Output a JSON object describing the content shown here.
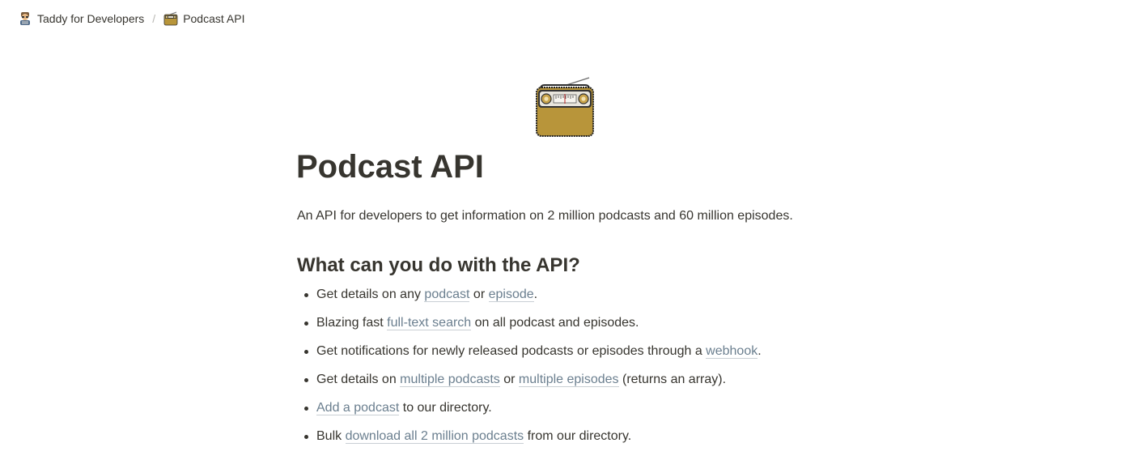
{
  "breadcrumb": {
    "root_label": "Taddy for Developers",
    "root_icon": "developer-avatar-icon",
    "separator": "/",
    "current_label": "Podcast API",
    "current_icon": "radio-icon"
  },
  "page": {
    "icon": "radio-icon",
    "title": "Podcast API",
    "intro": "An API for developers to get information on 2 million podcasts and 60 million episodes.",
    "section_heading": "What can you do with the API?"
  },
  "features": [
    {
      "t1": "Get details on any ",
      "l1": "podcast",
      "t2": " or ",
      "l2": "episode",
      "t3": "."
    },
    {
      "t1": "Blazing fast ",
      "l1": "full-text search",
      "t2": " on all podcast and episodes."
    },
    {
      "t1": "Get notifications for newly released podcasts or episodes through a ",
      "l1": "webhook",
      "t2": "."
    },
    {
      "t1": "Get details on ",
      "l1": "multiple podcasts",
      "t2": " or ",
      "l2": "multiple episodes",
      "t3": " (returns an array)."
    },
    {
      "t1": "",
      "l1": "Add a podcast",
      "t2": " to our directory."
    },
    {
      "t1": "Bulk ",
      "l1": "download all 2 million podcasts",
      "t2": " from our directory."
    }
  ],
  "colors": {
    "text": "#37352f",
    "link": "#6b7f8f",
    "radio_body": "#b8953a"
  }
}
